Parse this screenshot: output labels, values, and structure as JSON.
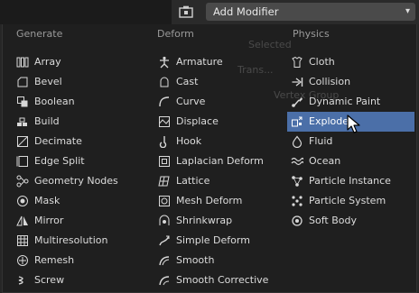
{
  "header": {
    "dropdown_label": "Add Modifier",
    "wrench_icon": "wrench-icon",
    "chevron_icon": "chevron-down-icon"
  },
  "ghost_text": [
    "Selected",
    "Trans...",
    "Vertex Group"
  ],
  "menu": {
    "columns": [
      {
        "header": "Generate",
        "items": [
          {
            "label": "Array",
            "icon": "array-icon"
          },
          {
            "label": "Bevel",
            "icon": "bevel-icon"
          },
          {
            "label": "Boolean",
            "icon": "boolean-icon"
          },
          {
            "label": "Build",
            "icon": "build-icon"
          },
          {
            "label": "Decimate",
            "icon": "decimate-icon"
          },
          {
            "label": "Edge Split",
            "icon": "edge-split-icon"
          },
          {
            "label": "Geometry Nodes",
            "icon": "geometry-nodes-icon"
          },
          {
            "label": "Mask",
            "icon": "mask-icon"
          },
          {
            "label": "Mirror",
            "icon": "mirror-icon"
          },
          {
            "label": "Multiresolution",
            "icon": "multiresolution-icon"
          },
          {
            "label": "Remesh",
            "icon": "remesh-icon"
          },
          {
            "label": "Screw",
            "icon": "screw-icon"
          }
        ]
      },
      {
        "header": "Deform",
        "items": [
          {
            "label": "Armature",
            "icon": "armature-icon"
          },
          {
            "label": "Cast",
            "icon": "cast-icon"
          },
          {
            "label": "Curve",
            "icon": "curve-icon"
          },
          {
            "label": "Displace",
            "icon": "displace-icon"
          },
          {
            "label": "Hook",
            "icon": "hook-icon"
          },
          {
            "label": "Laplacian Deform",
            "icon": "laplacian-deform-icon"
          },
          {
            "label": "Lattice",
            "icon": "lattice-icon"
          },
          {
            "label": "Mesh Deform",
            "icon": "mesh-deform-icon"
          },
          {
            "label": "Shrinkwrap",
            "icon": "shrinkwrap-icon"
          },
          {
            "label": "Simple Deform",
            "icon": "simple-deform-icon"
          },
          {
            "label": "Smooth",
            "icon": "smooth-icon"
          },
          {
            "label": "Smooth Corrective",
            "icon": "smooth-corrective-icon"
          }
        ]
      },
      {
        "header": "Physics",
        "items": [
          {
            "label": "Cloth",
            "icon": "cloth-icon"
          },
          {
            "label": "Collision",
            "icon": "collision-icon"
          },
          {
            "label": "Dynamic Paint",
            "icon": "dynamic-paint-icon"
          },
          {
            "label": "Explode",
            "icon": "explode-icon",
            "selected": true
          },
          {
            "label": "Fluid",
            "icon": "fluid-icon"
          },
          {
            "label": "Ocean",
            "icon": "ocean-icon"
          },
          {
            "label": "Particle Instance",
            "icon": "particle-instance-icon"
          },
          {
            "label": "Particle System",
            "icon": "particle-system-icon"
          },
          {
            "label": "Soft Body",
            "icon": "soft-body-icon"
          }
        ]
      }
    ]
  },
  "colors": {
    "menu_bg": "#1f1f1f",
    "selected_bg": "#4b6fa8",
    "dropdown_bg": "#4a4a4a"
  }
}
